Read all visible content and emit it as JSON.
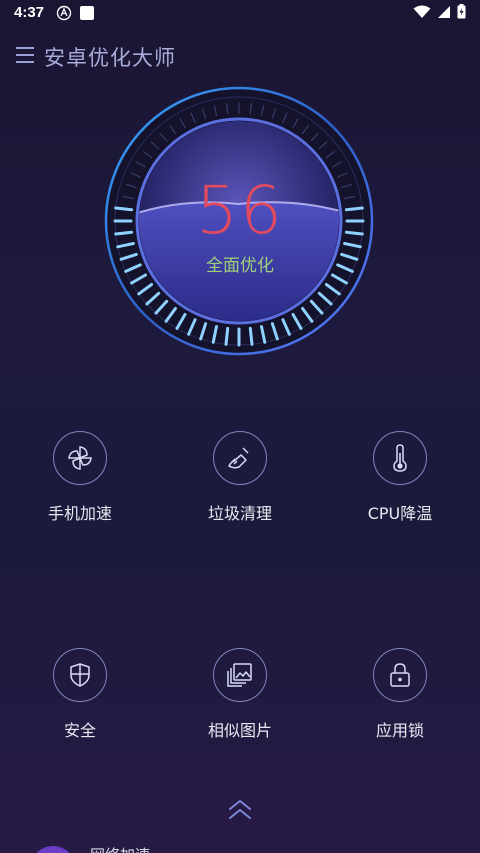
{
  "status_bar": {
    "time": "4:37"
  },
  "header": {
    "title": "安卓优化大师"
  },
  "gauge": {
    "score": "56",
    "label": "全面优化"
  },
  "features": [
    {
      "label": "手机加速",
      "icon": "fan-icon"
    },
    {
      "label": "垃圾清理",
      "icon": "broom-icon"
    },
    {
      "label": "CPU降温",
      "icon": "thermometer-icon"
    },
    {
      "label": "安全",
      "icon": "shield-icon"
    },
    {
      "label": "相似图片",
      "icon": "gallery-icon"
    },
    {
      "label": "应用锁",
      "icon": "lock-icon"
    }
  ],
  "bottom": {
    "label": "网络加速"
  },
  "colors": {
    "score": "#e24b5d",
    "label_green": "#9fd07a",
    "accent_blue": "#49b7ff"
  }
}
